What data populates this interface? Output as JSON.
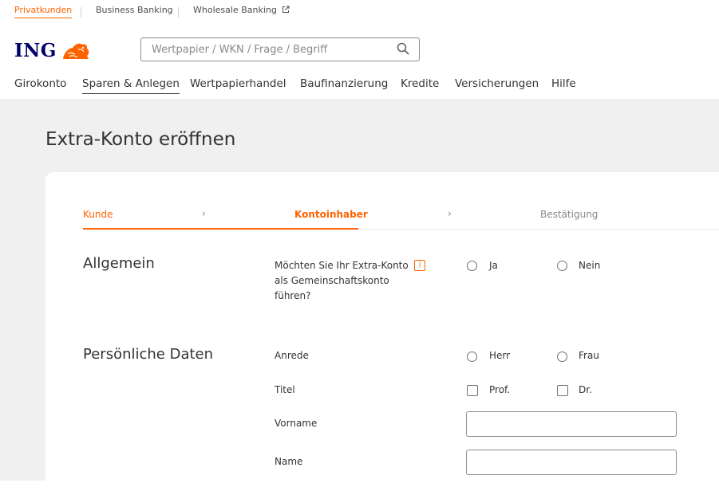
{
  "segments": {
    "items": [
      {
        "label": "Privatkunden"
      },
      {
        "label": "Business Banking"
      },
      {
        "label": "Wholesale Banking"
      }
    ],
    "active": "Privatkunden",
    "external_icon": "external-link-icon"
  },
  "logo": {
    "text": "ING",
    "icon": "lion-icon",
    "brand_color": "#000066",
    "accent_color": "#ff6200"
  },
  "search": {
    "placeholder": "Wertpapier / WKN / Frage / Begriff",
    "value": "",
    "icon": "search-icon"
  },
  "nav": {
    "items": [
      {
        "label": "Girokonto"
      },
      {
        "label": "Sparen & Anlegen"
      },
      {
        "label": "Wertpapierhandel"
      },
      {
        "label": "Baufinanzierung"
      },
      {
        "label": "Kredite"
      },
      {
        "label": "Versicherungen"
      },
      {
        "label": "Hilfe"
      }
    ],
    "active": "Sparen & Anlegen"
  },
  "page": {
    "title": "Extra-Konto eröffnen"
  },
  "stepper": {
    "steps": [
      {
        "label": "Kunde",
        "state": "done"
      },
      {
        "label": "Kontoinhaber",
        "state": "current"
      },
      {
        "label": "Bestätigung",
        "state": "todo"
      }
    ],
    "separator": "›"
  },
  "form": {
    "general": {
      "title": "Allgemein",
      "joint_account_question": {
        "label_lines": [
          "Möchten Sie Ihr Extra-Konto",
          "als Gemeinschaftskonto",
          "führen?"
        ],
        "info_icon": "i",
        "options": [
          {
            "label": "Ja",
            "selected": false
          },
          {
            "label": "Nein",
            "selected": false
          }
        ]
      }
    },
    "personal": {
      "title": "Persönliche Daten",
      "salutation": {
        "label": "Anrede",
        "options": [
          {
            "label": "Herr",
            "selected": false
          },
          {
            "label": "Frau",
            "selected": false
          }
        ]
      },
      "titel": {
        "label": "Titel",
        "options": [
          {
            "label": "Prof.",
            "checked": false
          },
          {
            "label": "Dr.",
            "checked": false
          }
        ]
      },
      "first_name": {
        "label": "Vorname",
        "value": ""
      },
      "last_name": {
        "label": "Name",
        "value": ""
      }
    }
  }
}
